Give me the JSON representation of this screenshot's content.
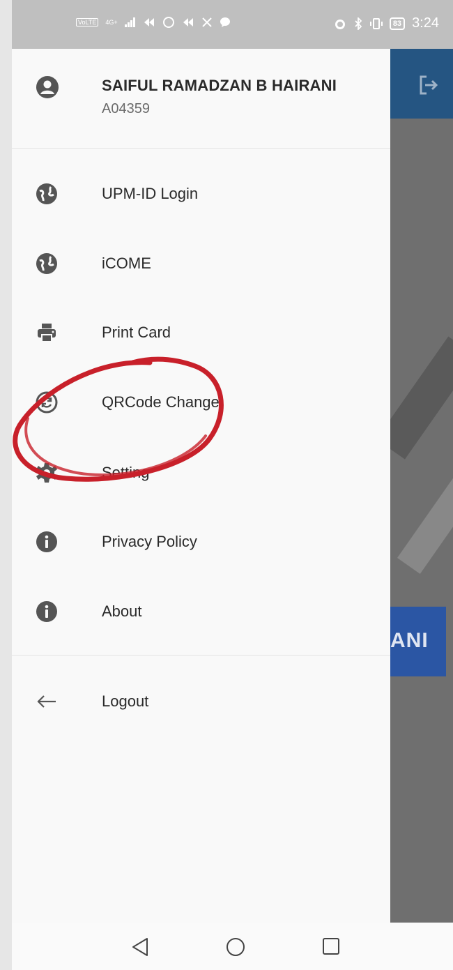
{
  "status_bar": {
    "left_badge": "VoLTE",
    "network": "4G+",
    "icons": [
      "signal-icon",
      "app-icon",
      "ring-icon",
      "app-icon",
      "x-icon",
      "chat-icon"
    ],
    "battery": "83",
    "time": "3:24"
  },
  "drawer": {
    "profile": {
      "name": "SAIFUL RAMADZAN B HAIRANI",
      "id": "A04359"
    },
    "items": [
      {
        "label": "UPM-ID Login",
        "icon": "globe-icon"
      },
      {
        "label": "iCOME",
        "icon": "globe-icon"
      },
      {
        "label": "Print Card",
        "icon": "printer-icon"
      },
      {
        "label": "QRCode Change",
        "icon": "sync-icon"
      },
      {
        "label": "Setting",
        "icon": "gear-icon"
      },
      {
        "label": "Privacy Policy",
        "icon": "info-icon"
      },
      {
        "label": "About",
        "icon": "info-icon"
      }
    ],
    "logout_label": "Logout"
  },
  "background_app": {
    "banner_text": "ANI",
    "header_color": "#255582",
    "banner_color": "#2b56a4"
  },
  "annotation_color": "#c8202a"
}
